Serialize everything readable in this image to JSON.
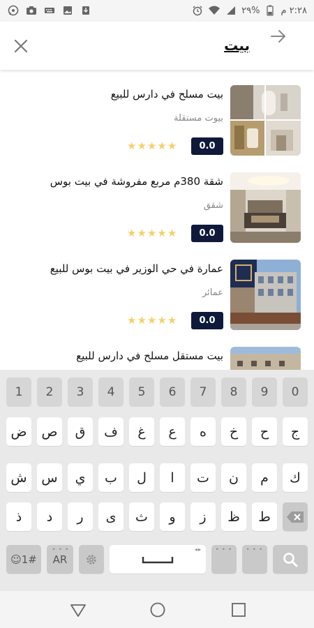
{
  "status_bar": {
    "time": "٢:٢٨ م",
    "battery": "%٢٩",
    "icons": [
      "whatsapp-icon",
      "camera-icon",
      "keyboard-icon",
      "gallery-icon",
      "download-icon",
      "alarm-icon",
      "wifi-icon",
      "signal-icon",
      "battery-icon"
    ]
  },
  "header": {
    "search_value": "بيت",
    "close_icon": "close-icon",
    "back_icon": "arrow-icon"
  },
  "results": [
    {
      "title": "بيت مسلح في دارس للبيع",
      "category": "بيوت مستقلة",
      "rating": "0.0",
      "stars": 5
    },
    {
      "title": "شقة 380م مربع مفروشة في بيت بوس",
      "category": "شقق",
      "rating": "0.0",
      "stars": 5
    },
    {
      "title": "عمارة في حي الوزير في بيت بوس للبيع",
      "category": "عمائر",
      "rating": "0.0",
      "stars": 5
    },
    {
      "title": "بيت مستقل مسلح في دارس للبيع",
      "category": "",
      "rating": "",
      "stars": 0
    }
  ],
  "keyboard": {
    "numbers": [
      "1",
      "2",
      "3",
      "4",
      "5",
      "6",
      "7",
      "8",
      "9",
      "0"
    ],
    "row1": [
      "ض",
      "ص",
      "ق",
      "ف",
      "غ",
      "ع",
      "ه",
      "خ",
      "ح",
      "ج"
    ],
    "row2": [
      "ش",
      "س",
      "ي",
      "ب",
      "ل",
      "ا",
      "ت",
      "ن",
      "م",
      "ك"
    ],
    "row3": [
      "ذ",
      "د",
      "ر",
      "ى",
      "ث",
      "و",
      "ز",
      "ظ",
      "ط"
    ],
    "symbols_label": "☺1#",
    "lang_label": "AR",
    "settings_icon": "settings-icon",
    "space_icon": "space-icon",
    "backspace_icon": "backspace-icon",
    "search_icon": "search-icon"
  },
  "navbar": {
    "back_icon": "back-triangle-icon",
    "home_icon": "home-circle-icon",
    "recent_icon": "recents-square-icon"
  },
  "colors": {
    "badge_bg": "#0f1a3a",
    "star": "#f6cf6a",
    "keyboard_bg": "#e9e9e9"
  }
}
